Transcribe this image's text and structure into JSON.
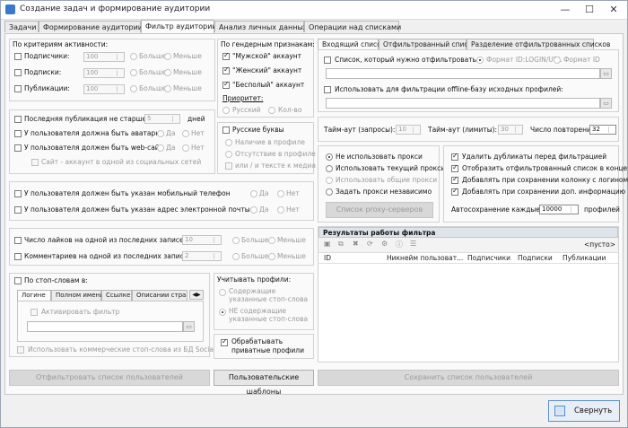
{
  "window": {
    "title": "Создание задач и формирование аудитории",
    "minimize": "—",
    "maximize": "☐",
    "close": "✕"
  },
  "tabs": [
    "Задачи",
    "Формирование аудитории",
    "Фильтр аудитории",
    "Анализ личных данных",
    "Операции над списками"
  ],
  "activity": {
    "title": "По критериям активности:",
    "rows": [
      {
        "label": "Подписчики:",
        "value": "100",
        "more": "Больше",
        "less": "Меньше"
      },
      {
        "label": "Подписки:",
        "value": "100",
        "more": "Больше",
        "less": "Меньше"
      },
      {
        "label": "Публикации:",
        "value": "100",
        "more": "Больше",
        "less": "Меньше"
      }
    ]
  },
  "lastpub": {
    "label": "Последняя публикация не старше",
    "value": "5",
    "unit": "дней"
  },
  "avatar": {
    "label": "У пользователя должна быть аватарка",
    "yes": "Да",
    "no": "Нет"
  },
  "website": {
    "label": "У пользователя должен быть web-сайт",
    "yes": "Да",
    "no": "Нет",
    "sub": "Сайт - аккаунт в одной из социальных сетей"
  },
  "phone": {
    "label": "У пользователя должен быть указан мобильный телефон",
    "yes": "Да",
    "no": "Нет"
  },
  "email": {
    "label": "У пользователя должен быть указан адрес электронной почты",
    "yes": "Да",
    "no": "Нет"
  },
  "likes": {
    "label": "Число лайков на одной из последних записей:",
    "value": "10",
    "more": "Больше",
    "less": "Меньше"
  },
  "comments": {
    "label": "Комментариев на одной из последних записей:",
    "value": "2",
    "more": "Больше",
    "less": "Меньше"
  },
  "stopwords": {
    "label": "По стоп-словам в:",
    "tabs": [
      "Логине",
      "Полном имени",
      "Ссылке",
      "Описании страни"
    ],
    "activate": "Активировать фильтр",
    "commercial": "Использовать коммерческие стоп-слова из БД SocialKit"
  },
  "gender": {
    "title": "По гендерным признакам:",
    "items": [
      "\"Мужской\" аккаунт",
      "\"Женский\" аккаунт",
      "\"Бесполый\" аккаунт"
    ],
    "priority": "Приоритет:",
    "ru": "Русский",
    "lat": "Кол-во"
  },
  "russian": {
    "label": "Русские буквы",
    "opt1": "Наличие в профиле",
    "opt2": "Отсутствие в профиле",
    "opt3": "или / и тексте к медиа"
  },
  "consider": {
    "title": "Учитывать профили:",
    "opt1": "Содержащие указанные стоп-слова",
    "opt2": "НЕ содержащие указанные стоп-слова"
  },
  "private": {
    "label": "Обрабатывать приватные профили"
  },
  "buttons": {
    "filter": "Отфильтровать список пользователей",
    "templates": "Пользовательские шаблоны",
    "save": "Сохранить список пользователей",
    "collapse": "Свернуть"
  },
  "right_tabs": [
    "Входящий список",
    "Отфильтрованный список",
    "Разделение отфильтрованных списков"
  ],
  "incoming": {
    "list_label": "Список, который нужно отфильтровать:",
    "fmt1": "Формат ID:LOGIN/URL",
    "fmt2": "Формат ID",
    "offline_label": "Использовать для фильтрации offline-базу исходных профилей:"
  },
  "timeouts": {
    "req_label": "Тайм-аут (запросы):",
    "req_value": "10",
    "lim_label": "Тайм-аут (лимиты):",
    "lim_value": "30",
    "rep_label": "Число повторений:",
    "rep_value": "32"
  },
  "proxy": {
    "opts": [
      "Не использовать прокси",
      "Использовать текущий прокси",
      "Использовать общие прокси",
      "Задать прокси независимо"
    ],
    "button": "Список proxy-серверов"
  },
  "options": {
    "items": [
      "Удалить дубликаты перед фильтрацией",
      "Отобразить отфильтрованный список в конце",
      "Добавлять при сохранении колонку с логином",
      "Добавлять при сохранении доп. информацию"
    ],
    "autosave_label": "Автосохранение каждые",
    "autosave_value": "10000",
    "autosave_unit": "профилей"
  },
  "results": {
    "title": "Результаты работы фильтра",
    "empty": "<пусто>",
    "columns": [
      "ID",
      "Никнейм пользоват...",
      "Подписчики",
      "Подписки",
      "Публикации"
    ]
  },
  "colors": {
    "accent": "#3a78c9",
    "header_bg": "#dfe4ea",
    "panel": "#fafafa"
  }
}
